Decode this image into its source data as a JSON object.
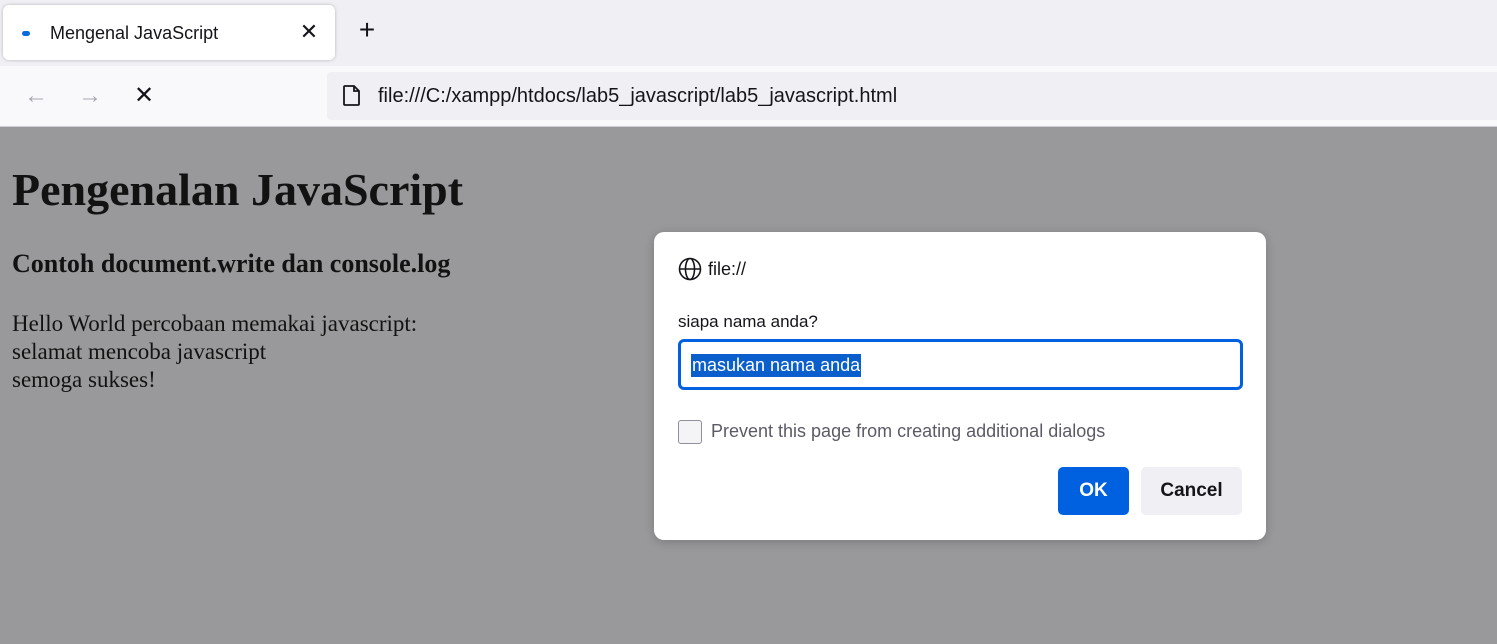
{
  "tab": {
    "title": "Mengenal JavaScript",
    "close_glyph": "✕",
    "new_tab_glyph": "+"
  },
  "nav": {
    "back_glyph": "←",
    "forward_glyph": "→",
    "stop_glyph": "✕",
    "url": "file:///C:/xampp/htdocs/lab5_javascript/lab5_javascript.html"
  },
  "page": {
    "heading": "Pengenalan JavaScript",
    "subheading": "Contoh document.write dan console.log",
    "lines": [
      "Hello World percobaan memakai javascript:",
      "selamat mencoba javascript",
      "semoga sukses!"
    ]
  },
  "dialog": {
    "origin": "file://",
    "message": "siapa nama anda?",
    "input_value": "masukan nama anda",
    "checkbox_label": "Prevent this page from creating additional dialogs",
    "ok_label": "OK",
    "cancel_label": "Cancel"
  },
  "colors": {
    "accent": "#0061e0",
    "overlay": "#99999b"
  },
  "icons": {
    "page": "page-icon",
    "globe": "globe-icon"
  }
}
